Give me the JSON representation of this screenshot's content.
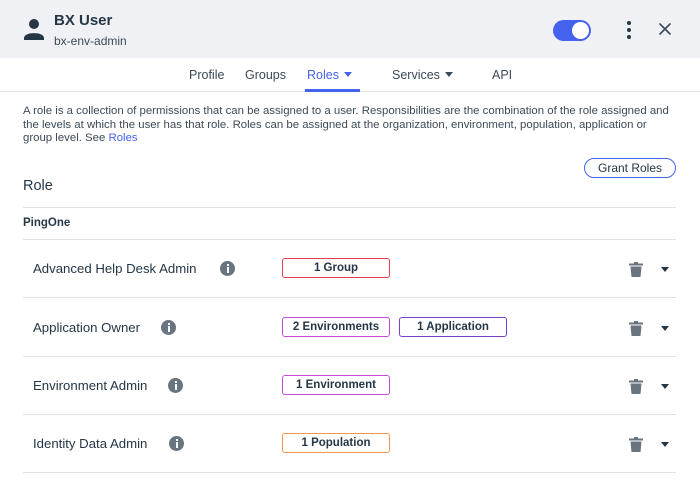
{
  "header": {
    "user_name": "BX User",
    "user_id": "bx-env-admin",
    "enabled": true,
    "accent_color": "#4462ed"
  },
  "tabs": [
    {
      "label": "Profile",
      "active": false,
      "has_menu": false
    },
    {
      "label": "Groups",
      "active": false,
      "has_menu": false
    },
    {
      "label": "Roles",
      "active": true,
      "has_menu": true
    },
    {
      "label": "Services",
      "active": false,
      "has_menu": true
    },
    {
      "label": "API",
      "active": false,
      "has_menu": false
    }
  ],
  "description": {
    "text": "A role is a collection of permissions that can be assigned to a user. Responsibilities are the combination of the role assigned and the levels at which the user has that role. Roles can be assigned at the organization, environment, population, application or group level. See ",
    "link": "Roles"
  },
  "grant_button": "Grant Roles",
  "role_heading": "Role",
  "section_title": "PingOne",
  "roles": [
    {
      "name": "Advanced Help Desk Admin",
      "badges": [
        {
          "label": "1 Group",
          "color": "#e0414f"
        }
      ]
    },
    {
      "name": "Application Owner",
      "badges": [
        {
          "label": "2 Environments",
          "color": "#c84ad9"
        },
        {
          "label": "1 Application",
          "color": "#7b3fc9"
        }
      ]
    },
    {
      "name": "Environment Admin",
      "badges": [
        {
          "label": "1 Environment",
          "color": "#c84ad9"
        }
      ]
    },
    {
      "name": "Identity Data Admin",
      "badges": [
        {
          "label": "1 Population",
          "color": "#f0974b"
        }
      ]
    }
  ],
  "icons": {
    "user": "person-icon",
    "more": "kebab-icon",
    "close": "close-icon",
    "info": "info-icon",
    "delete": "trash-icon",
    "expand": "chevron-down-icon"
  }
}
